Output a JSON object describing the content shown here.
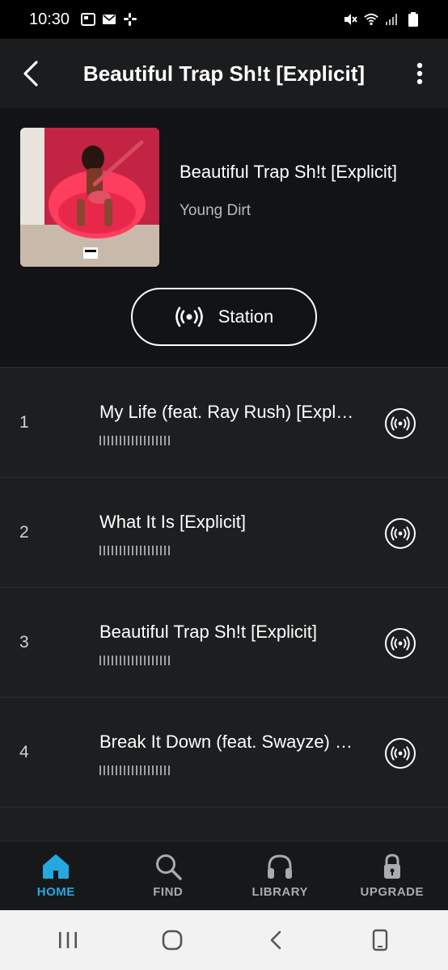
{
  "status_bar": {
    "time": "10:30"
  },
  "header": {
    "title": "Beautiful Trap Sh!t [Explicit]"
  },
  "album": {
    "title": "Beautiful Trap Sh!t [Explicit]",
    "artist": "Young Dirt"
  },
  "station_button": {
    "label": "Station"
  },
  "tracks": [
    {
      "number": "1",
      "title": "My Life (feat. Ray Rush) [Explicit]"
    },
    {
      "number": "2",
      "title": "What It Is [Explicit]"
    },
    {
      "number": "3",
      "title": "Beautiful Trap Sh!t [Explicit]"
    },
    {
      "number": "4",
      "title": "Break It Down (feat. Swayze) [Explicit]"
    }
  ],
  "bottom_nav": {
    "items": [
      {
        "label": "HOME",
        "icon": "home-icon",
        "active": true
      },
      {
        "label": "FIND",
        "icon": "search-icon",
        "active": false
      },
      {
        "label": "LIBRARY",
        "icon": "headphones-icon",
        "active": false
      },
      {
        "label": "UPGRADE",
        "icon": "lock-icon",
        "active": false
      }
    ]
  },
  "colors": {
    "accent": "#25a8e0",
    "background": "#111315",
    "row": "#1c1e20",
    "album_art": "#d8304f"
  }
}
